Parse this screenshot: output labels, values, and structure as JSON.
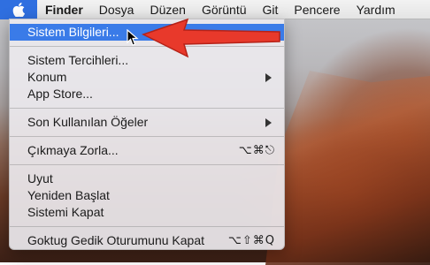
{
  "menubar": {
    "apple_icon": "apple-logo-icon",
    "items": [
      "Finder",
      "Dosya",
      "Düzen",
      "Görüntü",
      "Git",
      "Pencere",
      "Yardım"
    ]
  },
  "apple_menu": {
    "items": [
      {
        "label": "Sistem Bilgileri...",
        "highlighted": true
      },
      {
        "label": "Sistem Tercihleri..."
      },
      {
        "label": "Konum",
        "submenu": true
      },
      {
        "label": "App Store..."
      },
      {
        "label": "Son Kullanılan Öğeler",
        "submenu": true
      },
      {
        "label": "Çıkmaya Zorla...",
        "shortcut": "⌥⌘⎋"
      },
      {
        "label": "Uyut"
      },
      {
        "label": "Yeniden Başlat"
      },
      {
        "label": "Sistemi Kapat"
      },
      {
        "label": "Goktug Gedik Oturumunu Kapat",
        "shortcut": "⌥⇧⌘Q"
      }
    ]
  },
  "colors": {
    "highlight": "#3a7be8",
    "annotation_arrow": "#e8392b"
  }
}
